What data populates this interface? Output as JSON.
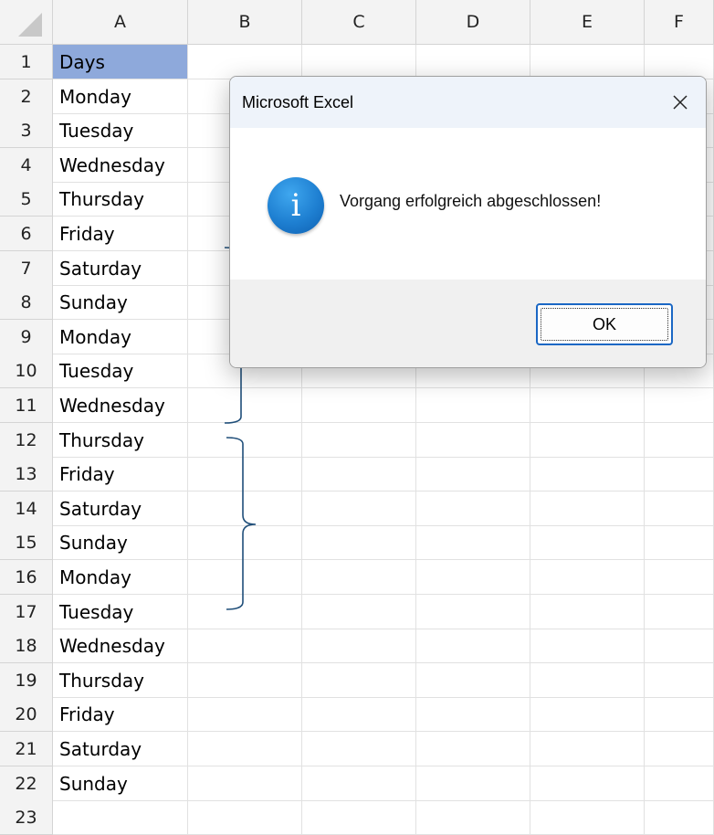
{
  "sheet": {
    "columns": [
      "A",
      "B",
      "C",
      "D",
      "E",
      "F"
    ],
    "rows": [
      {
        "n": "1",
        "a": "Days"
      },
      {
        "n": "2",
        "a": "Monday"
      },
      {
        "n": "3",
        "a": "Tuesday"
      },
      {
        "n": "4",
        "a": "Wednesday"
      },
      {
        "n": "5",
        "a": "Thursday"
      },
      {
        "n": "6",
        "a": "Friday"
      },
      {
        "n": "7",
        "a": "Saturday"
      },
      {
        "n": "8",
        "a": "Sunday"
      },
      {
        "n": "9",
        "a": "Monday"
      },
      {
        "n": "10",
        "a": "Tuesday"
      },
      {
        "n": "11",
        "a": "Wednesday"
      },
      {
        "n": "12",
        "a": "Thursday"
      },
      {
        "n": "13",
        "a": "Friday"
      },
      {
        "n": "14",
        "a": "Saturday"
      },
      {
        "n": "15",
        "a": "Sunday"
      },
      {
        "n": "16",
        "a": "Monday"
      },
      {
        "n": "17",
        "a": "Tuesday"
      },
      {
        "n": "18",
        "a": "Wednesday"
      },
      {
        "n": "19",
        "a": "Thursday"
      },
      {
        "n": "20",
        "a": "Friday"
      },
      {
        "n": "21",
        "a": "Saturday"
      },
      {
        "n": "22",
        "a": "Sunday"
      },
      {
        "n": "23",
        "a": ""
      }
    ],
    "header_fill_color": "#8ea9db",
    "brace_color": "#1f4e79"
  },
  "dialog": {
    "title": "Microsoft Excel",
    "close_icon": "close-icon",
    "icon": "info-icon",
    "icon_glyph": "i",
    "message": "Vorgang erfolgreich abgeschlossen!",
    "ok_label": "OK"
  }
}
